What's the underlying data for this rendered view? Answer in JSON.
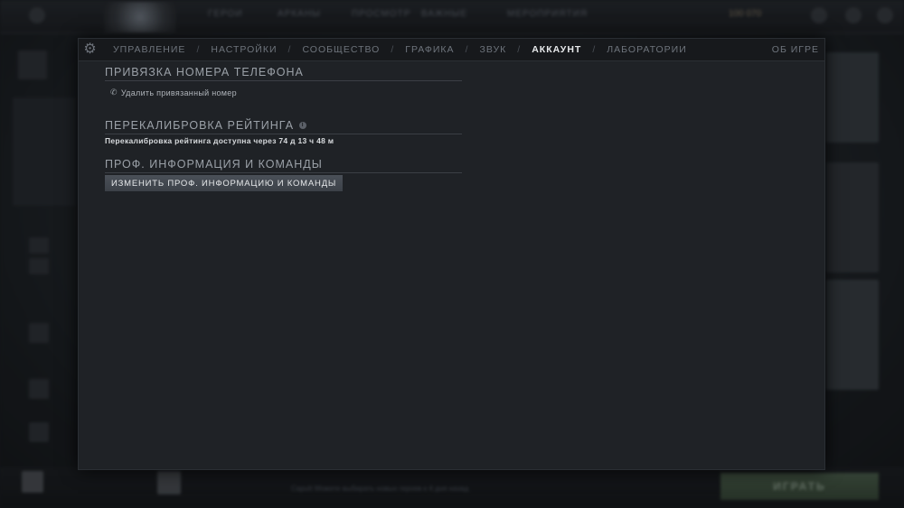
{
  "background": {
    "top_nav": [
      "ГЕРОИ",
      "АРКАНЫ",
      "ПРОСМОТР",
      "ВАЖНЫЕ",
      "МЕРОПРИЯТИЯ"
    ],
    "gold": "100 070",
    "play_label": "ИГРАТЬ",
    "status_name": "Caputt",
    "status_text": "Можете выбирать новых героев к 4 дня назад"
  },
  "settings": {
    "tabs": [
      "УПРАВЛЕНИЕ",
      "НАСТРОЙКИ",
      "СООБЩЕСТВО",
      "ГРАФИКА",
      "ЗВУК",
      "АККАУНТ",
      "ЛАБОРАТОРИИ"
    ],
    "active_tab": "АККАУНТ",
    "separator": "/",
    "about_label": "ОБ ИГРЕ",
    "phone_section": {
      "title": "ПРИВЯЗКА НОМЕРА ТЕЛЕФОНА",
      "remove_label": "Удалить привязанный номер"
    },
    "recalibration": {
      "title": "ПЕРЕКАЛИБРОВКА РЕЙТИНГА",
      "status_text": "Перекалибровка рейтинга доступна через 74 д 13 ч 48 м"
    },
    "pro_info": {
      "title": "ПРОФ. ИНФОРМАЦИЯ И КОМАНДЫ",
      "button_label": "ИЗМЕНИТЬ ПРОФ. ИНФОРМАЦИЮ И КОМАНДЫ"
    }
  }
}
